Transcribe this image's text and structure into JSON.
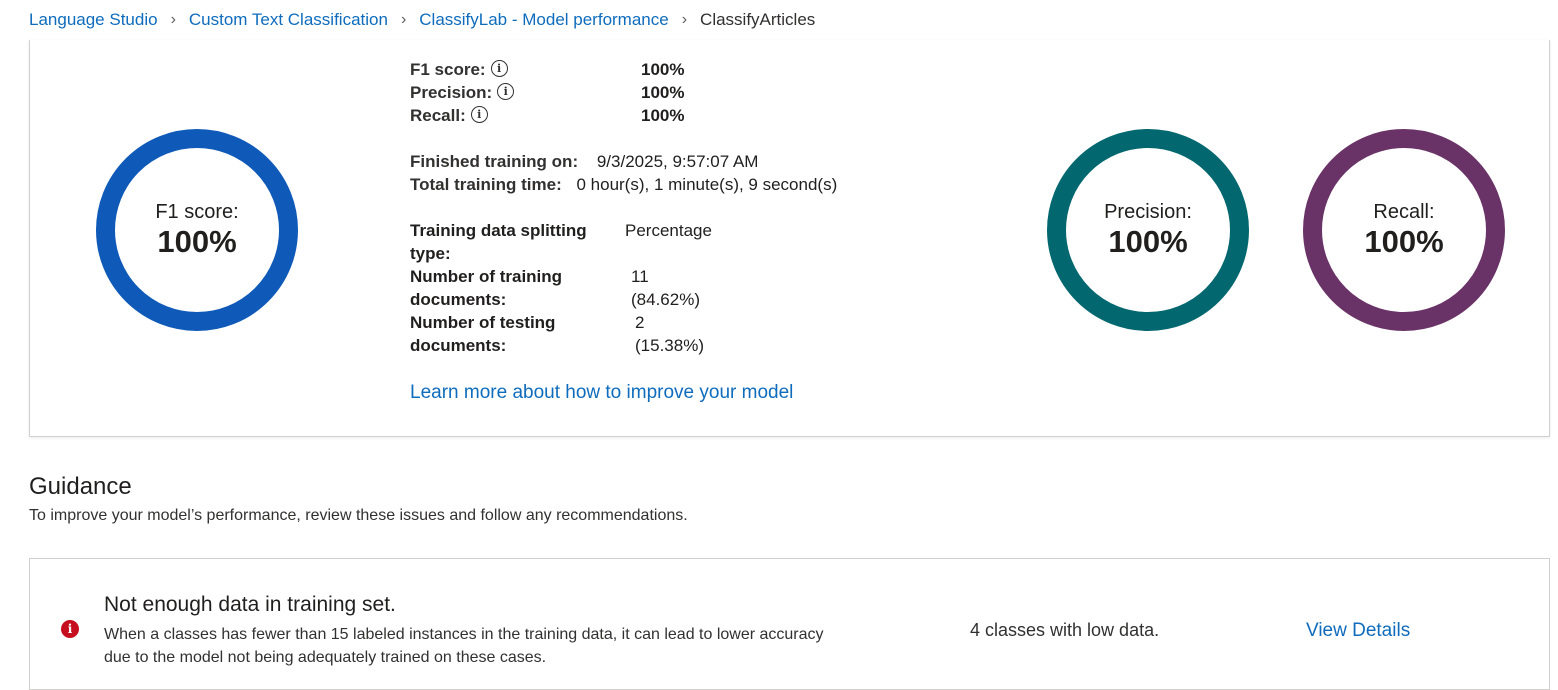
{
  "breadcrumb": {
    "items": [
      "Language Studio",
      "Custom Text Classification",
      "ClassifyLab - Model performance"
    ],
    "current": "ClassifyArticles",
    "separator": "›"
  },
  "metrics": {
    "scores": [
      {
        "label": "F1 score:",
        "value": "100%"
      },
      {
        "label": "Precision:",
        "value": "100%"
      },
      {
        "label": "Recall:",
        "value": "100%"
      }
    ],
    "info_icon": "i",
    "finished_label": "Finished training on:",
    "finished_value": "9/3/2025, 9:57:07 AM",
    "total_time_label": "Total training time:",
    "total_time_value": "0 hour(s), 1 minute(s), 9 second(s)",
    "split_type_label": "Training data splitting type:",
    "split_type_value": "Percentage",
    "training_docs_label": "Number of training documents:",
    "training_docs_count": "11",
    "training_docs_pct": "(84.62%)",
    "testing_docs_label": "Number of testing documents:",
    "testing_docs_count": "2",
    "testing_docs_pct": "(15.38%)",
    "learn_more": "Learn more about how to improve your model"
  },
  "rings": {
    "f1": {
      "label": "F1 score:",
      "value": "100%",
      "color": "#0f5ab8"
    },
    "precision": {
      "label": "Precision:",
      "value": "100%",
      "color": "#02676e"
    },
    "recall": {
      "label": "Recall:",
      "value": "100%",
      "color": "#6a3368"
    }
  },
  "guidance": {
    "title": "Guidance",
    "subtitle": "To improve your model’s performance, review these issues and follow any recommendations.",
    "issue": {
      "icon": "error-icon",
      "icon_glyph": "i",
      "title": "Not enough data in training set.",
      "description": "When a classes has fewer than 15 labeled instances in the training data, it can lead to lower accuracy due to the model not being adequately trained on these cases.",
      "count": "4 classes with low data.",
      "link": "View Details"
    }
  },
  "colors": {
    "link": "#0f6cbd",
    "error": "#c50f1f"
  }
}
